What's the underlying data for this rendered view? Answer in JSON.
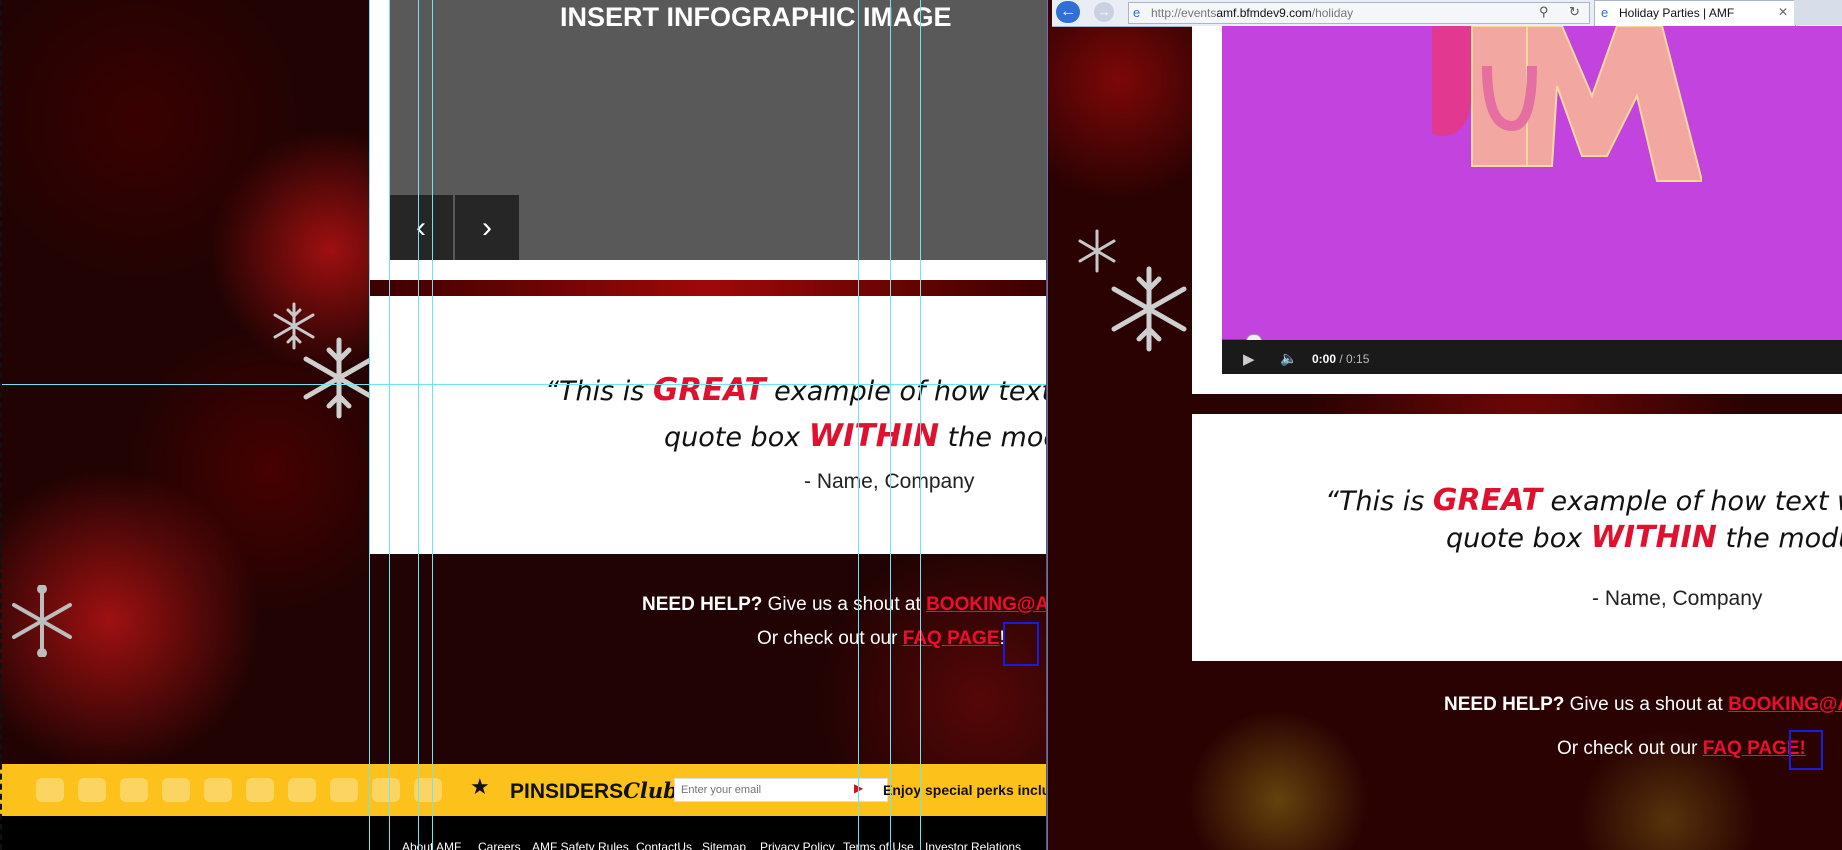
{
  "left_pane": {
    "infographic_title": "INSERT INFOGRAPHIC IMAGE",
    "prev_icon": "chevron-left-icon",
    "next_icon": "chevron-right-icon",
    "quote": {
      "open_mark": "“",
      "part1": "This is ",
      "emphasis1": "GREAT",
      "part2": " example of how text wil",
      "part3": "quote box ",
      "emphasis2": "WITHIN",
      "part4": " the modu",
      "attribution": "- Name, Company"
    },
    "help": {
      "bold": "NEED HELP?",
      "text1": " Give us a shout at ",
      "email_link": "BOOKING@A",
      "text2": "Or check out our ",
      "faq_link": "FAQ PAGE",
      "excl": "!"
    },
    "pinsiders": {
      "star_icon": "star-icon",
      "brand_plain": "PINSIDERS",
      "brand_script": "Club",
      "email_placeholder": "Enter your email",
      "submit_icon": "play-triangle-icon",
      "perks": "Enjoy special perks includ"
    },
    "footer_links": [
      "About AMF",
      "Careers",
      "AMF Safety Rules",
      "ContactUs",
      "Sitemap",
      "Privacy Policy",
      "Terms of Use",
      "Investor Relations"
    ]
  },
  "browser": {
    "back_icon": "back-arrow-icon",
    "forward_icon": "forward-arrow-icon",
    "url_prefix": "http://events",
    "url_domain": "amf.bfmdev9.com",
    "url_path": "/holiday",
    "search_icon": "search-icon",
    "refresh_icon": "refresh-icon",
    "tab_title": "Holiday Parties | AMF",
    "tab_close": "✕",
    "video": {
      "play_icon": "play-icon",
      "volume_icon": "volume-icon",
      "current_time": "0:00",
      "separator": " / ",
      "duration": "0:15",
      "progress": 0.05
    },
    "quote": {
      "open_mark": "“",
      "part1": "This is ",
      "emphasis1": "GREAT",
      "part2": " example of how text wi",
      "part3": "quote box ",
      "emphasis2": "WITHIN",
      "part4": " the modu",
      "attribution": "- Name, Company"
    },
    "help": {
      "bold": "NEED HELP?",
      "text1": " Give us a shout at ",
      "email_link": "BOOKING@AI",
      "text2": "Or check out our ",
      "faq_link": "FAQ PAGE",
      "excl": "!"
    }
  },
  "colors": {
    "accent_red": "#e0102f",
    "yellow_bar": "#fcc21b",
    "video_bg": "#c243de",
    "guide_cyan": "#6de6f0",
    "selection_blue": "#1a1ae0"
  }
}
